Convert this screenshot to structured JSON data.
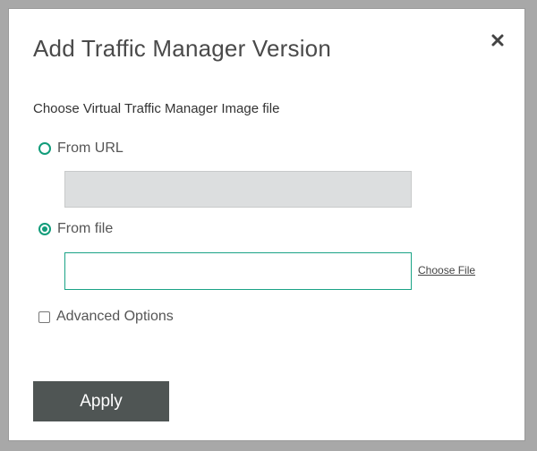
{
  "dialog": {
    "title": "Add Traffic Manager Version",
    "close_icon": "close-icon",
    "section_label": "Choose Virtual Traffic Manager Image file",
    "from_url": {
      "label": "From URL",
      "selected": false,
      "value": ""
    },
    "from_file": {
      "label": "From file",
      "selected": true,
      "value": ""
    },
    "choose_file_label": "Choose File",
    "advanced_options": {
      "label": "Advanced Options",
      "checked": false
    },
    "apply_label": "Apply"
  },
  "colors": {
    "accent": "#119c7a",
    "button_bg": "#4f5554",
    "disabled_input_bg": "#dcdedf",
    "overlay": "#a8a8a8"
  }
}
